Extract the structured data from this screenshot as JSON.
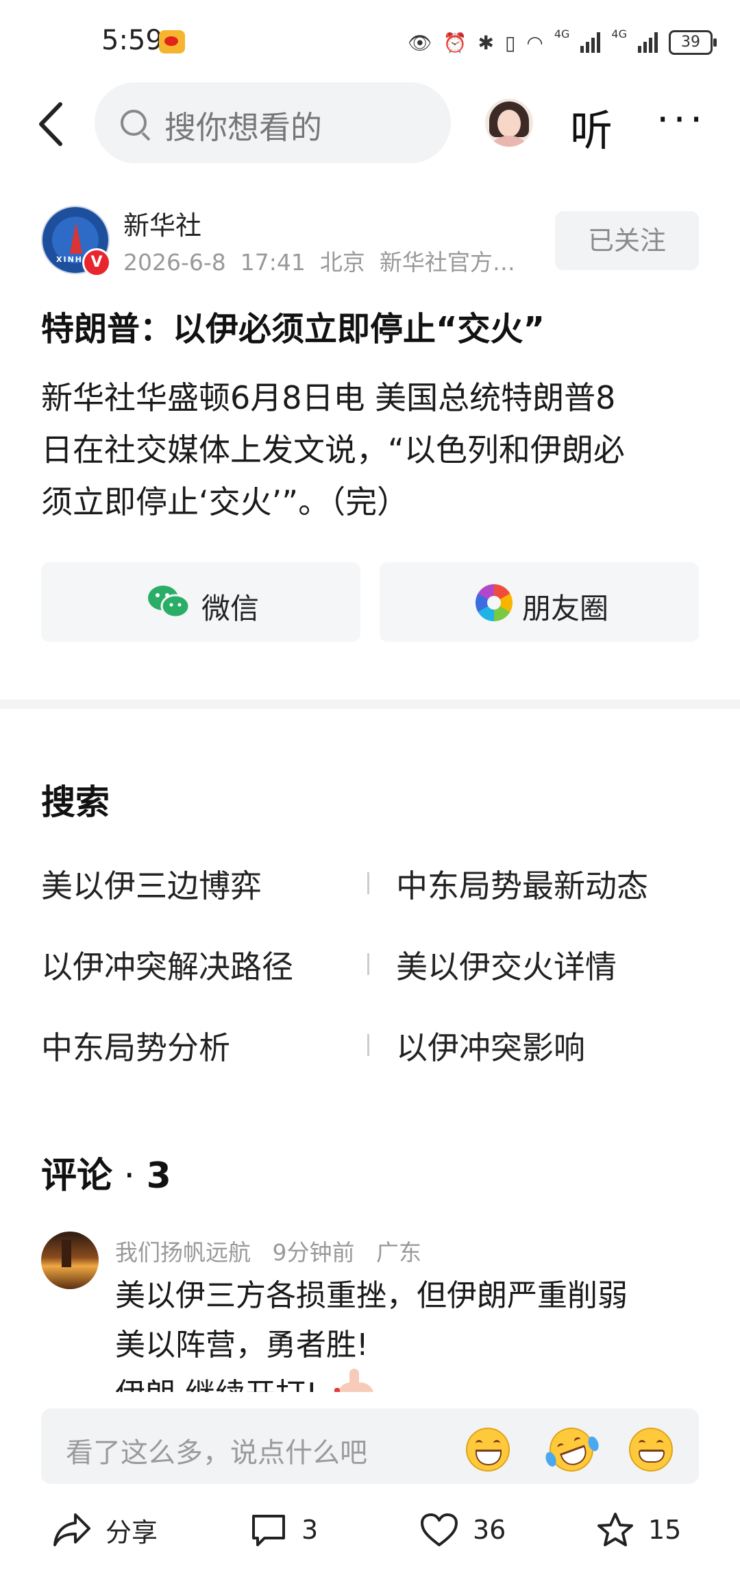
{
  "status_bar": {
    "time": "5:59",
    "battery": "39",
    "network1": "4G",
    "network2": "4G"
  },
  "top_bar": {
    "search_placeholder": "搜你想看的",
    "listen_label": "听",
    "more_label": "···"
  },
  "author": {
    "name": "新华社",
    "date": "2026-6-8",
    "time": "17:41",
    "location": "北京",
    "source": "新华社官方…",
    "follow_label": "已关注",
    "badge": "V"
  },
  "article": {
    "title": "特朗普：以伊必须立即停止“交火”",
    "body_lines": [
      "新华社华盛顿6月8日电 美国总统特朗普8",
      "日在社交媒体上发文说，“以色列和伊朗必",
      "须立即停止‘交火’”。（完）"
    ]
  },
  "share": {
    "wechat_label": "微信",
    "moments_label": "朋友圈"
  },
  "search_section": {
    "title": "搜索",
    "items": [
      "美以伊三边博弈",
      "中东局势最新动态",
      "以伊冲突解决路径",
      "美以伊交火详情",
      "中东局势分析",
      "以伊冲突影响"
    ]
  },
  "comments": {
    "title": "评论",
    "count": "3",
    "items": [
      {
        "user": "我们扬帆远航",
        "time": "9分钟前",
        "location": "广东",
        "lines": [
          "美以伊三方各损重挫，但伊朗严重削弱",
          "美以阵营，勇者胜!",
          "伊朗·继续开打!"
        ]
      }
    ]
  },
  "input_bar": {
    "placeholder": "看了这么多，说点什么吧"
  },
  "actions": {
    "share_label": "分享",
    "comments_count": "3",
    "likes_count": "36",
    "favorites_count": "15"
  }
}
